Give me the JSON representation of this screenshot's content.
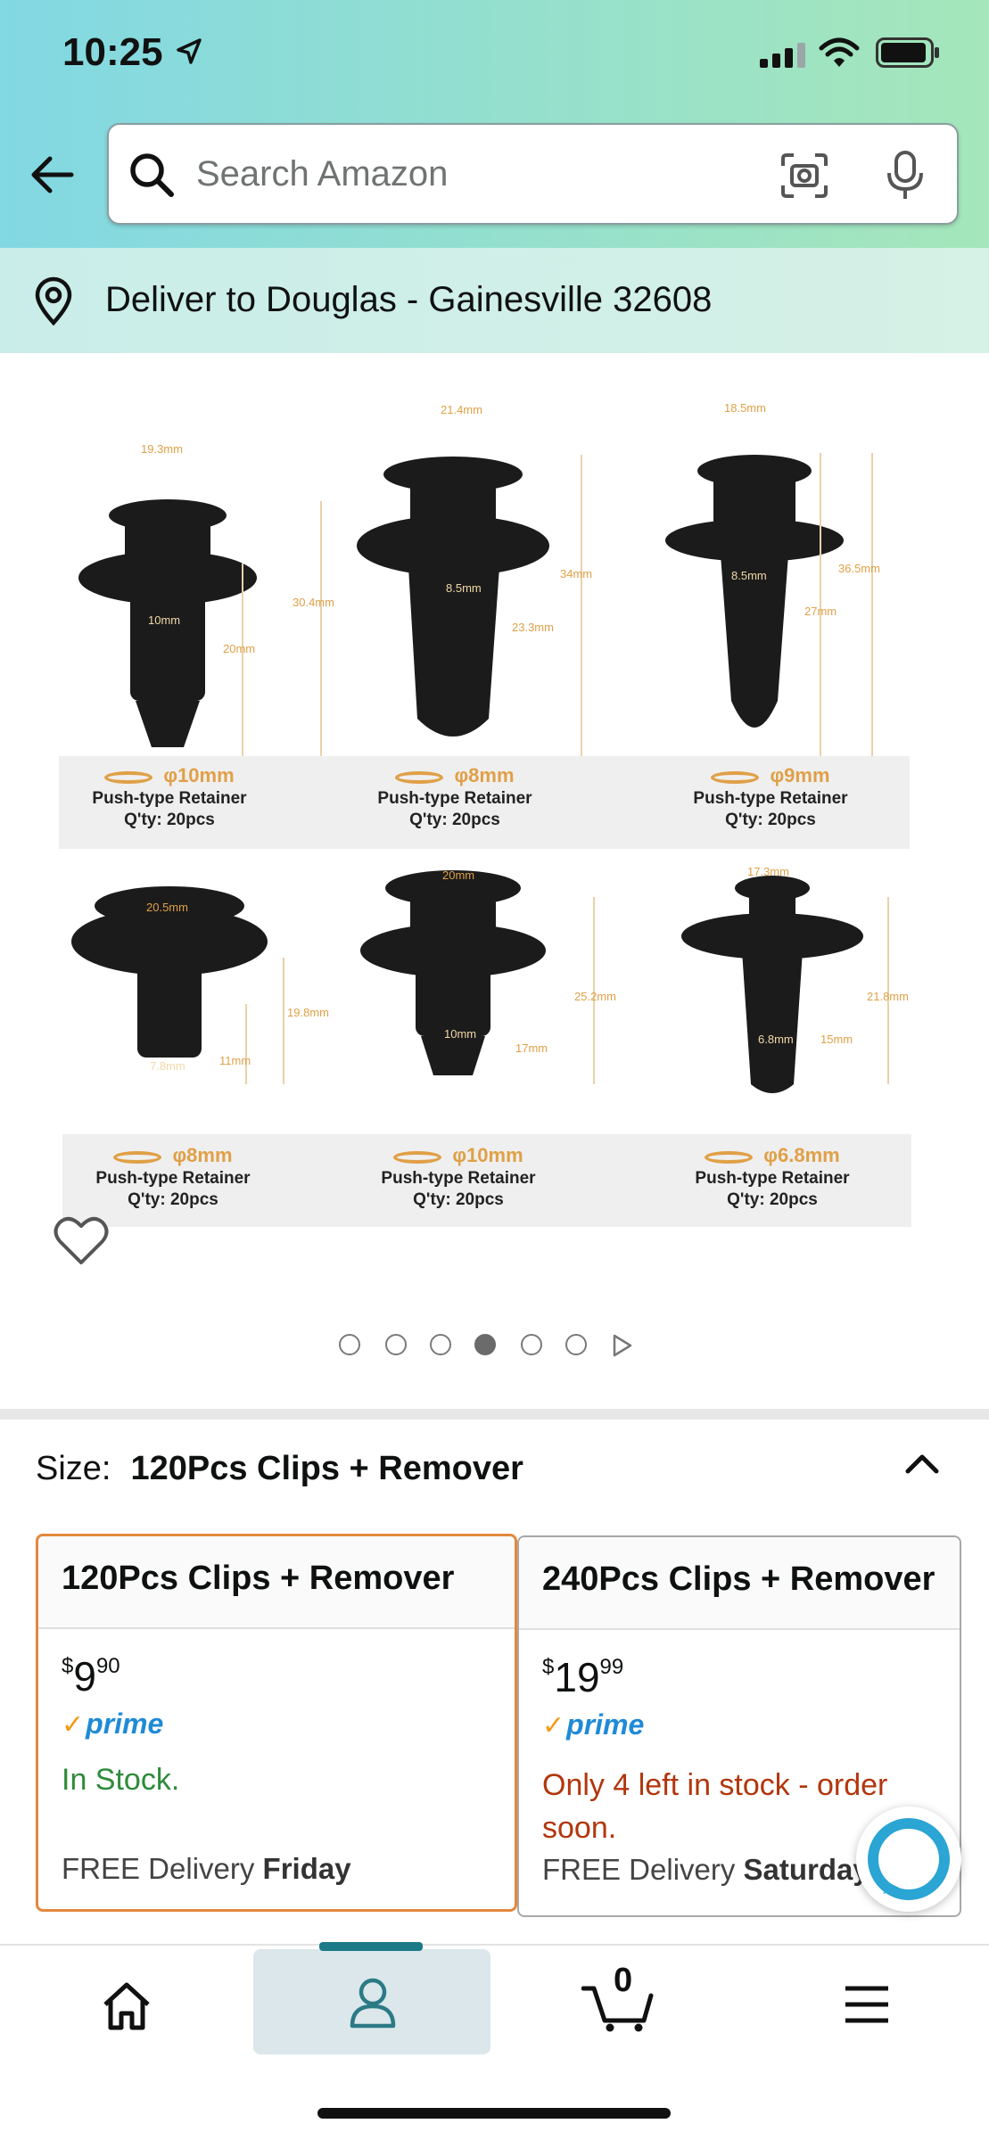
{
  "status_bar": {
    "time": "10:25"
  },
  "header": {
    "search_placeholder": "Search Amazon"
  },
  "deliver": {
    "text": "Deliver to Douglas - Gainesville 32608"
  },
  "product_image": {
    "clips": [
      {
        "diameter": "φ10mm",
        "name": "Push-type Retainer",
        "qty": "Q'ty: 20pcs",
        "dims": [
          "19.3mm",
          "10mm",
          "20mm",
          "30.4mm"
        ]
      },
      {
        "diameter": "φ8mm",
        "name": "Push-type Retainer",
        "qty": "Q'ty: 20pcs",
        "dims": [
          "21.4mm",
          "8.5mm",
          "34mm",
          "23.3mm"
        ]
      },
      {
        "diameter": "φ9mm",
        "name": "Push-type Retainer",
        "qty": "Q'ty: 20pcs",
        "dims": [
          "18.5mm",
          "8.5mm",
          "27mm",
          "36.5mm"
        ]
      },
      {
        "diameter": "φ8mm",
        "name": "Push-type Retainer",
        "qty": "Q'ty: 20pcs",
        "dims": [
          "20.5mm",
          "7.8mm",
          "11mm",
          "19.8mm"
        ]
      },
      {
        "diameter": "φ10mm",
        "name": "Push-type Retainer",
        "qty": "Q'ty: 20pcs",
        "dims": [
          "20mm",
          "10mm",
          "17mm",
          "25.2mm"
        ]
      },
      {
        "diameter": "φ6.8mm",
        "name": "Push-type Retainer",
        "qty": "Q'ty: 20pcs",
        "dims": [
          "17.3mm",
          "6.8mm",
          "15mm",
          "21.8mm"
        ]
      }
    ],
    "carousel": {
      "count": 6,
      "active_index": 3
    }
  },
  "size_selector": {
    "label": "Size:",
    "selected": "120Pcs Clips + Remover"
  },
  "options": [
    {
      "title": "120Pcs Clips + Remover",
      "currency": "$",
      "price_whole": "9",
      "price_fraction": "90",
      "prime": "prime",
      "stock": "In Stock.",
      "delivery_prefix": "FREE Delivery",
      "delivery_day": "Friday"
    },
    {
      "title": "240Pcs Clips + Remover",
      "currency": "$",
      "price_whole": "19",
      "price_fraction": "99",
      "prime": "prime",
      "stock": "Only 4 left in stock - order soon.",
      "delivery_prefix": "FREE Delivery",
      "delivery_day": "Saturday"
    }
  ],
  "bottom_nav": {
    "cart_count": "0"
  },
  "colors": {
    "header_gradient_start": "#82d8e3",
    "header_gradient_end": "#a5e6ba",
    "selected_border": "#e3883c",
    "prime_blue": "#1f8ad6",
    "in_stock_green": "#2e8b3a",
    "low_stock_red": "#b2360d",
    "nav_active_bg": "#dbe7ea",
    "nav_indicator": "#1c7a88"
  },
  "icons": [
    "location-arrow-icon",
    "signal-icon",
    "wifi-icon",
    "battery-icon",
    "back-arrow-icon",
    "search-icon",
    "camera-icon",
    "microphone-icon",
    "location-pin-icon",
    "heart-icon",
    "chevron-up-icon",
    "chat-icon",
    "home-icon",
    "user-icon",
    "cart-icon",
    "menu-icon"
  ]
}
